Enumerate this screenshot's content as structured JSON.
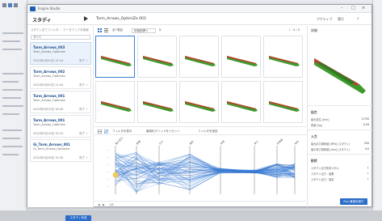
{
  "window": {
    "app_title": "Inspire Studio",
    "minimize": "–",
    "maximize": "□",
    "close": "×"
  },
  "studybar": {
    "title": "スタディ",
    "study_name": "Tarm_Arrows_OptimiZe 003",
    "right_item_1": "アクティブ",
    "right_item_2": "実行",
    "help": "?"
  },
  "left_panel": {
    "search_placeholder": "スタディ名でフィルタ ... データブックを検索",
    "sort_label": "すべて",
    "cards": [
      {
        "title": "Tarm_Arrows_003",
        "subtitle": "Tarm_Arrows_Optimize",
        "date": "2021年5月20日 12:24",
        "status": "完了 ✓"
      },
      {
        "title": "Tarm_Arrows_002",
        "subtitle": "Tarm_Arrows_Optimize",
        "date": "2021年5月20日 11:04",
        "status": "完了 ✓"
      },
      {
        "title": "Tarm_Arrows_001",
        "subtitle": "Tarm_Arrows_Optimize",
        "date": "2021年5月19日 16:40",
        "status": "完了 ✓"
      },
      {
        "title": "Tarm_Arrows_001",
        "subtitle": "Tarm_Arrows_Optimize",
        "date": "2021年5月19日 10:12",
        "status": "完了 ✓"
      },
      {
        "title": "Gi_Tarm_Arrows_001",
        "subtitle": "Gi_Tarm_Arrows_Optimize",
        "date": "2021年5月18日 15:30",
        "status": "完了 ✓"
      }
    ],
    "new_study_button": "スタディ作成"
  },
  "main": {
    "view_label": "全7項目",
    "dropdown": "評価指標 ▾",
    "pager": "1 - 8 / 8",
    "mid_labels": [
      "フィルタを表示",
      "最適化グリッドをリセット",
      "フィルタを追加"
    ],
    "footer": [
      "◀",
      "▶",
      "1/8"
    ]
  },
  "parallel": {
    "axes": [
      "最大変位",
      "質量",
      "応力",
      "剛性",
      "体積",
      "厚さ",
      "評価値",
      "制約"
    ]
  },
  "right_panel": {
    "header": "詳細",
    "sections": [
      {
        "title": "出力",
        "rows": [
          {
            "label": "最大変位 [mm]",
            "value": "0.755"
          },
          {
            "label": "質量 [kg]",
            "value": "0.29"
          }
        ]
      },
      {
        "title": "入力",
        "rows": [
          {
            "label": "最大応力制約値 [MPa] (スタディ)",
            "value": "250"
          },
          {
            "label": "最小厚さ制約値 [mm] (スタディ)",
            "value": "4.0"
          }
        ]
      },
      {
        "title": "形状",
        "rows": [
          {
            "label": "スタディ出力形状 (STL)",
            "value": "↓"
          },
          {
            "label": "スタディ出力 - 結果",
            "value": "↓"
          },
          {
            "label": "スタディ出力 - 設定",
            "value": "↓"
          }
        ]
      }
    ],
    "run_button": "Run 最適化実行"
  },
  "colors": {
    "accent": "#2b6dc9",
    "shape_green": "#3f9a2e",
    "shape_red": "#c8382c",
    "line_blue": "#3c7fd8",
    "highlight": "#f2c94c"
  }
}
